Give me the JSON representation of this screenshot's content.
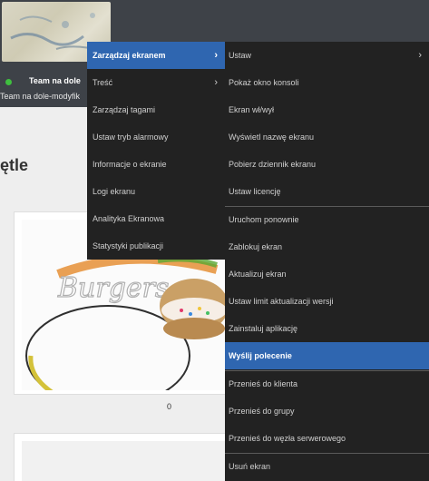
{
  "header": {
    "screen_name": "Team na dole",
    "screen_subtitle": "Team na dole-modyfik",
    "status_color": "#3fbf3f"
  },
  "main": {
    "section_title": "ętle",
    "card_count": "0",
    "card_image_text": "Burgers"
  },
  "context_menu": {
    "items": [
      {
        "label": "Zarządzaj ekranem",
        "has_submenu": true,
        "active": true
      },
      {
        "label": "Treść",
        "has_submenu": true
      },
      {
        "label": "Zarządzaj tagami"
      },
      {
        "label": "Ustaw tryb alarmowy"
      },
      {
        "label": "Informacje o ekranie"
      },
      {
        "label": "Logi ekranu"
      },
      {
        "label": "Analityka Ekranowa"
      },
      {
        "label": "Statystyki publikacji"
      }
    ]
  },
  "submenu": {
    "items": [
      {
        "label": "Ustaw",
        "has_submenu": true
      },
      {
        "label": "Pokaż okno konsoli"
      },
      {
        "label": "Ekran wł/wył"
      },
      {
        "label": "Wyświetl nazwę ekranu"
      },
      {
        "label": "Pobierz dziennik ekranu"
      },
      {
        "label": "Ustaw licencję"
      },
      {
        "label": "Uruchom ponownie"
      },
      {
        "label": "Zablokuj ekran"
      },
      {
        "label": "Aktualizuj ekran"
      },
      {
        "label": "Ustaw limit aktualizacji wersji"
      },
      {
        "label": "Zainstaluj aplikację"
      },
      {
        "label": "Wyślij polecenie",
        "active": true
      },
      {
        "label": "Przenieś do klienta"
      },
      {
        "label": "Przenieś do grupy"
      },
      {
        "label": "Przenieś do węzła serwerowego"
      },
      {
        "label": "Usuń ekran"
      }
    ]
  },
  "icons": {
    "submenu_arrow": "chevron-right-icon",
    "status": "online-status-dot"
  },
  "colors": {
    "menu_background": "#222222",
    "menu_highlight": "#2f66b0",
    "header_background": "#3e4248"
  }
}
